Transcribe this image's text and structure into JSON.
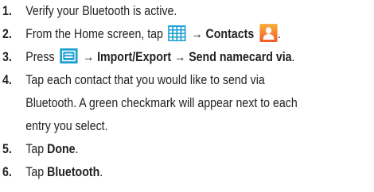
{
  "steps": [
    {
      "number": "1.",
      "text": "Verify your Bluetooth is active."
    },
    {
      "number": "2.",
      "text_before": "From the Home screen, tap",
      "arrow": "→",
      "bold": "Contacts",
      "icons": [
        "apps-grid-icon",
        "contacts-icon"
      ]
    },
    {
      "number": "3.",
      "text_before": "Press",
      "arrow": "→",
      "bold_1": "Import/Export",
      "bold_2": "Send namecard via",
      "trailing": ".",
      "icons": [
        "menu-icon"
      ]
    },
    {
      "number": "4.",
      "line1": "Tap each contact that you would like to send via",
      "line2": "Bluetooth. A green checkmark will appear next to each",
      "line3": "entry you select."
    },
    {
      "number": "5.",
      "text_before": "Tap",
      "bold": "Done",
      "trailing": "."
    },
    {
      "number": "6.",
      "text_before": "Tap",
      "bold": "Bluetooth",
      "trailing": "."
    }
  ],
  "colors": {
    "text": "#231f20",
    "apps_icon": "#1a9fd0",
    "contacts_icon": "#f7941d",
    "menu_icon": "#1a9fd0"
  }
}
